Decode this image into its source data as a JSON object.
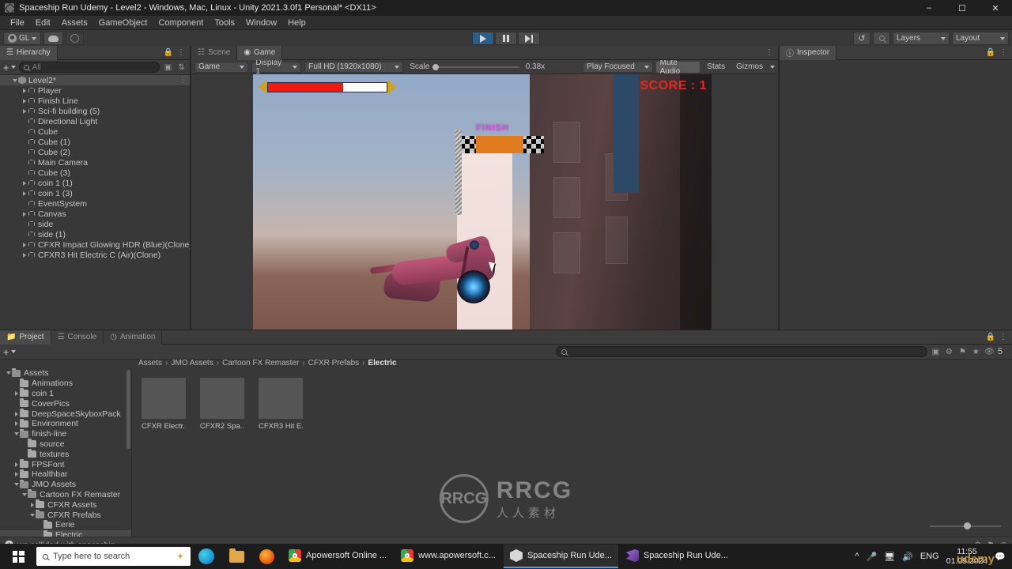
{
  "window": {
    "title": "Spaceship Run Udemy - Level2 - Windows, Mac, Linux - Unity 2021.3.0f1 Personal* <DX11>",
    "minimize": "–",
    "maximize": "☐",
    "close": "✕"
  },
  "menu": {
    "items": [
      "File",
      "Edit",
      "Assets",
      "GameObject",
      "Component",
      "Tools",
      "Window",
      "Help"
    ]
  },
  "toolbar": {
    "account_label": "GL",
    "layers_label": "Layers",
    "layout_label": "Layout",
    "play_state": "playing",
    "history_icon": "history-icon",
    "search_icon": "search-icon"
  },
  "hierarchy": {
    "tab_label": "Hierarchy",
    "search_placeholder": "All",
    "items": [
      {
        "label": "Level2*",
        "depth": 0,
        "expandable": true,
        "expanded": true,
        "selected": true,
        "icon": "unity-scene-icon"
      },
      {
        "label": "Player",
        "depth": 1,
        "expandable": true,
        "expanded": false,
        "selected": false,
        "icon": "gameobject-icon"
      },
      {
        "label": "Finish Line",
        "depth": 1,
        "expandable": true,
        "expanded": false,
        "selected": false,
        "icon": "gameobject-icon"
      },
      {
        "label": "Sci-fi building (5)",
        "depth": 1,
        "expandable": true,
        "expanded": false,
        "selected": false,
        "icon": "gameobject-icon"
      },
      {
        "label": "Directional Light",
        "depth": 1,
        "expandable": false,
        "expanded": false,
        "selected": false,
        "icon": "gameobject-icon"
      },
      {
        "label": "Cube",
        "depth": 1,
        "expandable": false,
        "expanded": false,
        "selected": false,
        "icon": "gameobject-icon"
      },
      {
        "label": "Cube (1)",
        "depth": 1,
        "expandable": false,
        "expanded": false,
        "selected": false,
        "icon": "gameobject-icon"
      },
      {
        "label": "Cube (2)",
        "depth": 1,
        "expandable": false,
        "expanded": false,
        "selected": false,
        "icon": "gameobject-icon"
      },
      {
        "label": "Main Camera",
        "depth": 1,
        "expandable": false,
        "expanded": false,
        "selected": false,
        "icon": "gameobject-icon"
      },
      {
        "label": "Cube (3)",
        "depth": 1,
        "expandable": false,
        "expanded": false,
        "selected": false,
        "icon": "gameobject-icon"
      },
      {
        "label": "coin 1 (1)",
        "depth": 1,
        "expandable": true,
        "expanded": false,
        "selected": false,
        "icon": "gameobject-icon"
      },
      {
        "label": "coin 1 (3)",
        "depth": 1,
        "expandable": true,
        "expanded": false,
        "selected": false,
        "icon": "gameobject-icon"
      },
      {
        "label": "EventSystem",
        "depth": 1,
        "expandable": false,
        "expanded": false,
        "selected": false,
        "icon": "gameobject-icon"
      },
      {
        "label": "Canvas",
        "depth": 1,
        "expandable": true,
        "expanded": false,
        "selected": false,
        "icon": "gameobject-icon"
      },
      {
        "label": "side",
        "depth": 1,
        "expandable": false,
        "expanded": false,
        "selected": false,
        "icon": "gameobject-icon"
      },
      {
        "label": "side (1)",
        "depth": 1,
        "expandable": false,
        "expanded": false,
        "selected": false,
        "icon": "gameobject-icon"
      },
      {
        "label": "CFXR Impact Glowing HDR (Blue)(Clone)",
        "depth": 1,
        "expandable": true,
        "expanded": false,
        "selected": false,
        "icon": "gameobject-icon"
      },
      {
        "label": "CFXR3 Hit Electric C (Air)(Clone)",
        "depth": 1,
        "expandable": true,
        "expanded": false,
        "selected": false,
        "icon": "gameobject-icon"
      }
    ]
  },
  "gameview": {
    "tabs": [
      {
        "label": "Scene",
        "active": false,
        "icon": "scene-grid-icon"
      },
      {
        "label": "Game",
        "active": true,
        "icon": "game-pad-icon"
      }
    ],
    "view_mode": "Game",
    "display": "Display 1",
    "resolution": "Full HD (1920x1080)",
    "scale_label": "Scale",
    "scale_value": "0.38x",
    "play_mode": "Play Focused",
    "mute_audio": "Mute Audio",
    "stats": "Stats",
    "gizmos": "Gizmos",
    "hud": {
      "score": "SCORE : 1",
      "finish": "FINISH",
      "health_percent": 63
    }
  },
  "inspector": {
    "tab_label": "Inspector",
    "lock_icon": "lock-icon",
    "menu_icon": "kebab-menu-icon"
  },
  "project": {
    "tabs": [
      {
        "label": "Project",
        "active": true,
        "icon": "folder-icon"
      },
      {
        "label": "Console",
        "active": false,
        "icon": "console-icon"
      },
      {
        "label": "Animation",
        "active": false,
        "icon": "animation-clock-icon"
      }
    ],
    "search_placeholder": "",
    "filter_count": "5",
    "breadcrumb": [
      "Assets",
      "JMO Assets",
      "Cartoon FX Remaster",
      "CFXR Prefabs",
      "Electric"
    ],
    "tree": [
      {
        "label": "Assets",
        "depth": 0,
        "expandable": true,
        "expanded": true,
        "selected": false
      },
      {
        "label": "Animations",
        "depth": 1,
        "expandable": false,
        "expanded": false,
        "selected": false
      },
      {
        "label": "coin 1",
        "depth": 1,
        "expandable": true,
        "expanded": false,
        "selected": false
      },
      {
        "label": "CoverPics",
        "depth": 1,
        "expandable": false,
        "expanded": false,
        "selected": false
      },
      {
        "label": "DeepSpaceSkyboxPack",
        "depth": 1,
        "expandable": true,
        "expanded": false,
        "selected": false
      },
      {
        "label": "Environment",
        "depth": 1,
        "expandable": true,
        "expanded": false,
        "selected": false
      },
      {
        "label": "finish-line",
        "depth": 1,
        "expandable": true,
        "expanded": true,
        "selected": false
      },
      {
        "label": "source",
        "depth": 2,
        "expandable": false,
        "expanded": false,
        "selected": false
      },
      {
        "label": "textures",
        "depth": 2,
        "expandable": false,
        "expanded": false,
        "selected": false
      },
      {
        "label": "FPSFont",
        "depth": 1,
        "expandable": true,
        "expanded": false,
        "selected": false
      },
      {
        "label": "Healthbar",
        "depth": 1,
        "expandable": true,
        "expanded": false,
        "selected": false
      },
      {
        "label": "JMO Assets",
        "depth": 1,
        "expandable": true,
        "expanded": true,
        "selected": false
      },
      {
        "label": "Cartoon FX Remaster",
        "depth": 2,
        "expandable": true,
        "expanded": true,
        "selected": false
      },
      {
        "label": "CFXR Assets",
        "depth": 3,
        "expandable": true,
        "expanded": false,
        "selected": false
      },
      {
        "label": "CFXR Prefabs",
        "depth": 3,
        "expandable": true,
        "expanded": true,
        "selected": false
      },
      {
        "label": "Eerie",
        "depth": 4,
        "expandable": false,
        "expanded": false,
        "selected": false
      },
      {
        "label": "Electric",
        "depth": 4,
        "expandable": false,
        "expanded": false,
        "selected": true
      }
    ],
    "assets": [
      {
        "label": "CFXR Electr...",
        "icon": "prefab-thumbnail"
      },
      {
        "label": "CFXR2 Spa...",
        "icon": "prefab-thumbnail"
      },
      {
        "label": "CFXR3 Hit E...",
        "icon": "prefab-thumbnail"
      }
    ]
  },
  "status": {
    "message": "we collided with spaceship",
    "icon": "warning-icon"
  },
  "taskbar": {
    "search_placeholder": "Type here to search",
    "pinned": [
      {
        "name": "edge-icon"
      },
      {
        "name": "file-explorer-icon"
      },
      {
        "name": "firefox-icon"
      }
    ],
    "tasks": [
      {
        "label": "Apowersoft Online ...",
        "icon": "chrome-icon",
        "active": false
      },
      {
        "label": "www.apowersoft.c...",
        "icon": "chrome-icon",
        "active": false
      },
      {
        "label": "Spaceship Run Ude...",
        "icon": "unity-icon",
        "active": true
      },
      {
        "label": "Spaceship Run Ude...",
        "icon": "visual-studio-icon",
        "active": false
      }
    ],
    "tray": {
      "language": "ENG",
      "time": "11:55",
      "date": "01.09.2024",
      "notification_count": "1"
    }
  },
  "watermark": {
    "brand": "RRCG",
    "sub": "人人素材",
    "corner": "udemy"
  }
}
